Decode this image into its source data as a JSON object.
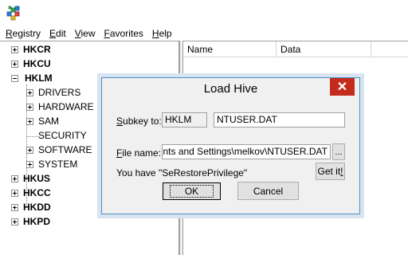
{
  "app": {
    "icon": "regedit-icon"
  },
  "menu": [
    {
      "key": "R",
      "rest": "egistry"
    },
    {
      "key": "E",
      "rest": "dit"
    },
    {
      "key": "V",
      "rest": "iew"
    },
    {
      "key": "F",
      "rest": "avorites"
    },
    {
      "key": "H",
      "rest": "elp"
    }
  ],
  "tree": {
    "hives": [
      "HKCR",
      "HKCU",
      "HKLM",
      "HKUS",
      "HKCC",
      "HKDD",
      "HKPD"
    ],
    "hklm_children": [
      "DRIVERS",
      "HARDWARE",
      "SAM",
      "SECURITY",
      "SOFTWARE",
      "SYSTEM"
    ]
  },
  "list": {
    "columns": [
      "Name",
      "Data"
    ]
  },
  "dialog": {
    "title": "Load Hive",
    "close_glyph": "✕",
    "subkey_label_key": "S",
    "subkey_label_rest": "ubkey to:",
    "subkey_root": "HKLM",
    "subkey_name": "NTUSER.DAT",
    "file_label_key": "F",
    "file_label_rest": "ile name:",
    "file_path": "C:\\Documents and Settings\\melkov\\NTUSER.DAT",
    "browse_label": "...",
    "privilege_text": "You have \"SeRestorePrivilege\"",
    "getit_pre": "Get it",
    "getit_post": "!",
    "ok_label": "OK",
    "cancel_label": "Cancel"
  }
}
